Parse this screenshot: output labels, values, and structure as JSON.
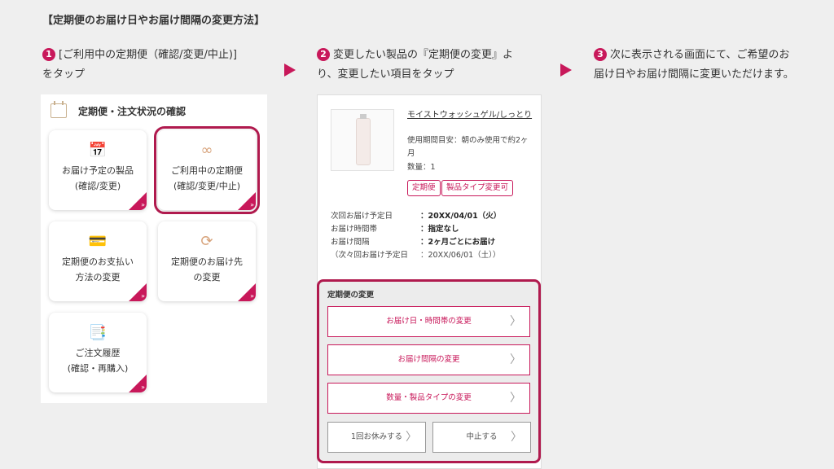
{
  "page_title": "【定期便のお届け日やお届け間隔の変更方法】",
  "steps": [
    {
      "num": "1",
      "text_line1": "[ご利用中の定期便（確認/変更/中止)]",
      "text_line2": "をタップ"
    },
    {
      "num": "2",
      "text_line1": "変更したい製品の『定期便の変更』よ",
      "text_line2": "り、変更したい項目をタップ"
    },
    {
      "num": "3",
      "text_line1": "次に表示される画面にて、ご希望のお",
      "text_line2": "届け日やお届け間隔に変更いただけます。"
    }
  ],
  "panel1": {
    "title": "定期便・注文状況の確認",
    "tiles": [
      {
        "line1": "お届け予定の製品",
        "line2": "(確認/変更)",
        "icon": "calendar-icon"
      },
      {
        "line1": "ご利用中の定期便",
        "line2": "(確認/変更/中止)",
        "icon": "infinity-calendar-icon"
      },
      {
        "line1": "定期便のお支払い",
        "line2": "方法の変更",
        "icon": "payment-icon"
      },
      {
        "line1": "定期便のお届け先",
        "line2": "の変更",
        "icon": "refresh-box-icon"
      },
      {
        "line1": "ご注文履歴",
        "line2": "(確認・再購入)",
        "icon": "history-icon"
      }
    ],
    "corner_mark": "»"
  },
  "panel2": {
    "product_name": "モイストウォッシュゲル/しっとり",
    "usage": "使用期間目安：朝のみ使用で約2ヶ月",
    "qty": "数量：1",
    "badges": [
      "定期便",
      "製品タイプ変更可"
    ],
    "info": [
      {
        "k": "次回お届け予定日",
        "v": "：20XX/04/01（火）",
        "bold": true
      },
      {
        "k": "お届け時間帯",
        "v": "：指定なし",
        "bold": true
      },
      {
        "k": "お届け間隔",
        "v": "：2ヶ月ごとにお届け",
        "bold": true
      },
      {
        "k": "（次々回お届け予定日",
        "v": "：20XX/06/01（土））",
        "bold": false
      }
    ],
    "change_section": {
      "title": "定期便の変更",
      "options": [
        "お届け日・時間帯の変更",
        "お届け間隔の変更",
        "数量・製品タイプの変更"
      ],
      "skip_button": "1回お休みする",
      "cancel_button": "中止する",
      "chevron": "〉"
    }
  },
  "colors": {
    "accent": "#c8185a",
    "highlight": "#b01a4e"
  }
}
